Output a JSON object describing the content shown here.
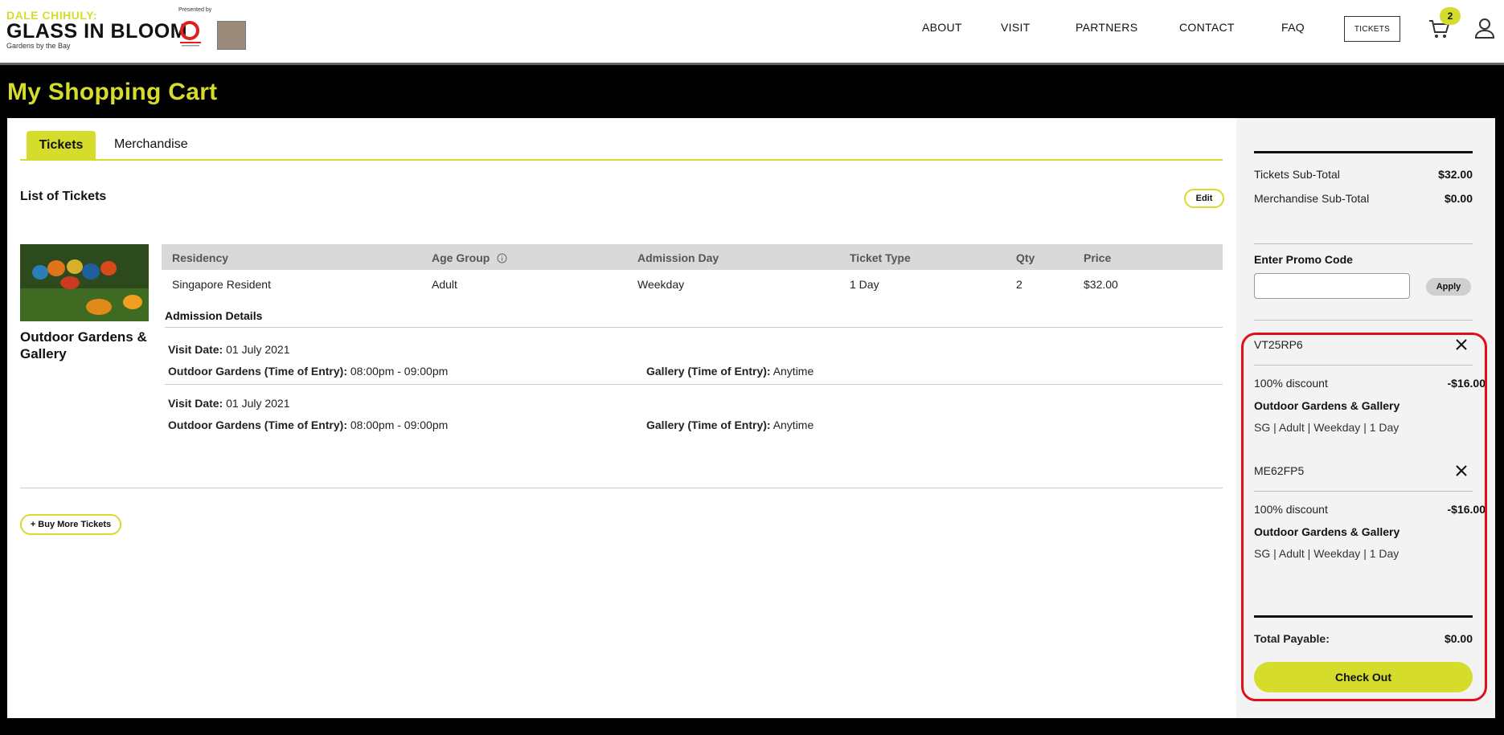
{
  "header": {
    "logo_line1": "DALE CHIHULY:",
    "logo_line2": "GLASS IN BLOOM",
    "logo_line3": "Gardens by the Bay",
    "presented_by": "Presented by",
    "nav": [
      "ABOUT",
      "VISIT",
      "PARTNERS",
      "CONTACT",
      "FAQ"
    ],
    "tickets_label": "TICKETS",
    "cart_count": "2",
    "icons": {
      "cart": "cart-icon",
      "user": "user-icon"
    }
  },
  "page_title": "My Shopping Cart",
  "tabs": [
    "Tickets",
    "Merchandise"
  ],
  "list_title": "List of Tickets",
  "edit_label": "Edit",
  "product": {
    "name": "Outdoor Gardens & Gallery",
    "columns": [
      "Residency",
      "Age Group",
      "Admission Day",
      "Ticket Type",
      "Qty",
      "Price"
    ],
    "row": [
      "Singapore Resident",
      "Adult",
      "Weekday",
      "1 Day",
      "2",
      "$32.00"
    ],
    "admission_title": "Admission Details",
    "visits": [
      {
        "date_label": "Visit Date:",
        "date": "01 July 2021",
        "entry_label": "Outdoor Gardens (Time of Entry):",
        "entry": "08:00pm - 09:00pm",
        "gallery_label": "Gallery (Time of Entry):",
        "gallery": "Anytime"
      },
      {
        "date_label": "Visit Date:",
        "date": "01 July 2021",
        "entry_label": "Outdoor Gardens (Time of Entry):",
        "entry": "08:00pm - 09:00pm",
        "gallery_label": "Gallery (Time of Entry):",
        "gallery": "Anytime"
      }
    ]
  },
  "buy_more_label": "+ Buy More Tickets",
  "summary": {
    "tickets_subtotal_label": "Tickets Sub-Total",
    "tickets_subtotal": "$32.00",
    "merch_subtotal_label": "Merchandise Sub-Total",
    "merch_subtotal": "$0.00",
    "promo_label": "Enter Promo Code",
    "promo_placeholder": "",
    "apply_label": "Apply",
    "promos": [
      {
        "code": "VT25RP6",
        "discount_label": "100% discount",
        "amount": "-$16.00",
        "product": "Outdoor Gardens & Gallery",
        "details": "SG | Adult | Weekday | 1 Day"
      },
      {
        "code": "ME62FP5",
        "discount_label": "100% discount",
        "amount": "-$16.00",
        "product": "Outdoor Gardens & Gallery",
        "details": "SG | Adult | Weekday | 1 Day"
      }
    ],
    "total_label": "Total Payable:",
    "total": "$0.00",
    "checkout_label": "Check Out"
  },
  "colors": {
    "accent": "#d6dc2b",
    "highlight": "#e0101a"
  }
}
